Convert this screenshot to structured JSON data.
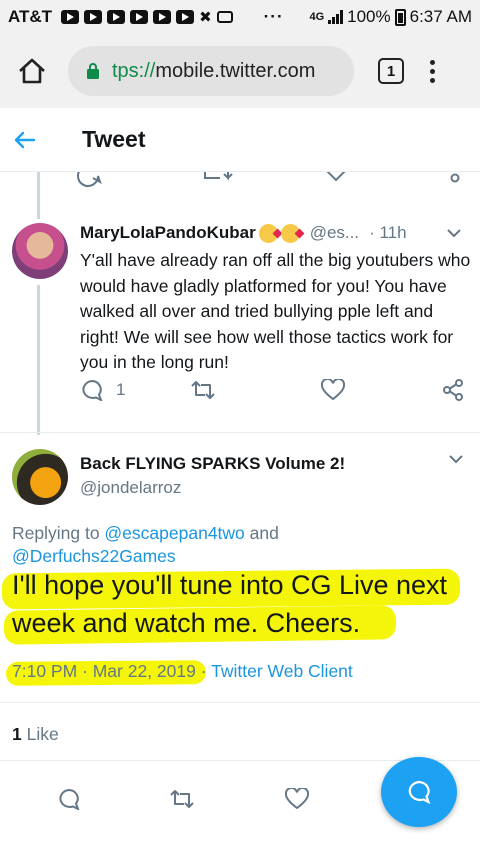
{
  "status_bar": {
    "carrier": "AT&T",
    "overflow": "···",
    "network": "4G",
    "battery": "100%",
    "time": "6:37 AM"
  },
  "browser": {
    "url_scheme": "tps://",
    "url_host": "mobile.twitter.com",
    "tab_count": "1"
  },
  "header": {
    "title": "Tweet"
  },
  "reply_tweet": {
    "display_name": "MaryLolaPandoKubar",
    "handle": "@es...",
    "time": "· 11h",
    "text": "Y'all have already ran off all the big youtubers who would have gladly platformed for you! You have walked all over and tried bullying pple left and right! We will see how well those tactics work for you in the long run!",
    "reply_count": "1"
  },
  "main_tweet": {
    "display_name": "Back FLYING SPARKS Volume 2!",
    "handle": "@jondelarroz",
    "replying_prefix": "Replying to ",
    "mention1": "@escapepan4two",
    "replying_and": " and",
    "mention2": "@Derfuchs22Games",
    "text": "I'll hope you'll tune into CG Live next week and watch me. Cheers.",
    "datetime": "7:10 PM · Mar 22, 2019",
    "separator": " · ",
    "client": "Twitter Web Client",
    "like_count": "1",
    "like_label": " Like"
  },
  "colors": {
    "accent": "#1da1f2",
    "highlight": "#f5f50a",
    "secure": "#0f8a4a"
  },
  "icons": [
    "home-icon",
    "lock-icon",
    "tabs-icon",
    "menu-icon",
    "back-arrow-icon",
    "reply-icon",
    "retweet-icon",
    "like-icon",
    "share-icon",
    "chevron-down-icon",
    "compose-icon"
  ]
}
